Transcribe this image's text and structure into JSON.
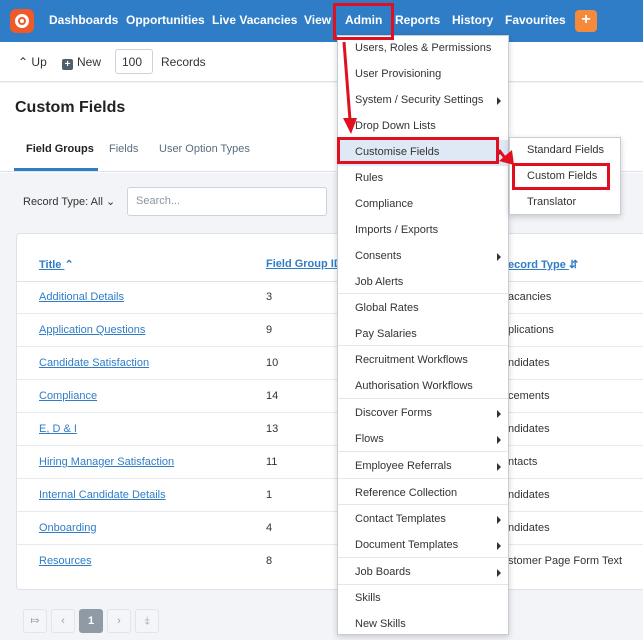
{
  "nav": {
    "items": [
      "Dashboards",
      "Opportunities",
      "Live Vacancies",
      "View",
      "Admin",
      "Reports",
      "History",
      "Favourites"
    ],
    "add_label": "+",
    "brand_color": "#2f7dc7"
  },
  "toolbar": {
    "up_label": "Up",
    "new_label": "New",
    "records_value": "100",
    "records_label": "Records"
  },
  "page": {
    "title": "Custom Fields",
    "tabs": [
      "Field Groups",
      "Fields",
      "User Option Types"
    ],
    "active_tab": "Field Groups",
    "record_type_label": "Record Type: All",
    "search_placeholder": "Search..."
  },
  "table": {
    "headers": [
      "Title",
      "Field Group ID",
      "ecord Type"
    ],
    "rows": [
      {
        "title": "Additional Details",
        "id": "3",
        "record_type": "acancies"
      },
      {
        "title": "Application Questions",
        "id": "9",
        "record_type": "plications"
      },
      {
        "title": "Candidate Satisfaction",
        "id": "10",
        "record_type": "ndidates"
      },
      {
        "title": "Compliance",
        "id": "14",
        "record_type": "cements"
      },
      {
        "title": "E, D & I",
        "id": "13",
        "record_type": "ndidates"
      },
      {
        "title": "Hiring Manager Satisfaction",
        "id": "11",
        "record_type": "ntacts"
      },
      {
        "title": "Internal Candidate Details",
        "id": "1",
        "record_type": "ndidates"
      },
      {
        "title": "Onboarding",
        "id": "4",
        "record_type": "ndidates"
      },
      {
        "title": "Resources",
        "id": "8",
        "record_type": "stomer Page Form Text"
      }
    ]
  },
  "pagination": {
    "current_page": "1",
    "first_icon": "first-page-icon",
    "prev_icon": "prev-page-icon",
    "next_icon": "next-page-icon",
    "last_icon": "last-page-icon"
  },
  "admin_menu": {
    "items": [
      {
        "label": "Users, Roles & Permissions",
        "submenu": false
      },
      {
        "label": "User Provisioning",
        "submenu": false
      },
      {
        "label": "System / Security Settings",
        "submenu": true
      },
      {
        "label": "Drop Down Lists",
        "submenu": false
      },
      {
        "label": "Customise Fields",
        "submenu": true,
        "selected": true
      },
      {
        "label": "Rules",
        "submenu": false
      },
      {
        "label": "Compliance",
        "submenu": false
      },
      {
        "label": "Imports / Exports",
        "submenu": false
      },
      {
        "label": "Consents",
        "submenu": true
      },
      {
        "label": "Job Alerts",
        "submenu": false
      },
      {
        "label": "Global Rates",
        "submenu": false
      },
      {
        "label": "Pay Salaries",
        "submenu": false
      },
      {
        "label": "Recruitment Workflows",
        "submenu": false
      },
      {
        "label": "Authorisation Workflows",
        "submenu": false
      },
      {
        "label": "Discover Forms",
        "submenu": true
      },
      {
        "label": "Flows",
        "submenu": true
      },
      {
        "label": "Employee Referrals",
        "submenu": true
      },
      {
        "label": "Reference Collection",
        "submenu": false
      },
      {
        "label": "Contact Templates",
        "submenu": true
      },
      {
        "label": "Document Templates",
        "submenu": true
      },
      {
        "label": "Job Boards",
        "submenu": true
      },
      {
        "label": "Skills",
        "submenu": false
      },
      {
        "label": "New Skills",
        "submenu": false
      }
    ]
  },
  "customise_submenu": {
    "items": [
      "Standard Fields",
      "Custom Fields",
      "Translator"
    ],
    "highlighted": "Custom Fields"
  },
  "annotation_color": "#e01020"
}
